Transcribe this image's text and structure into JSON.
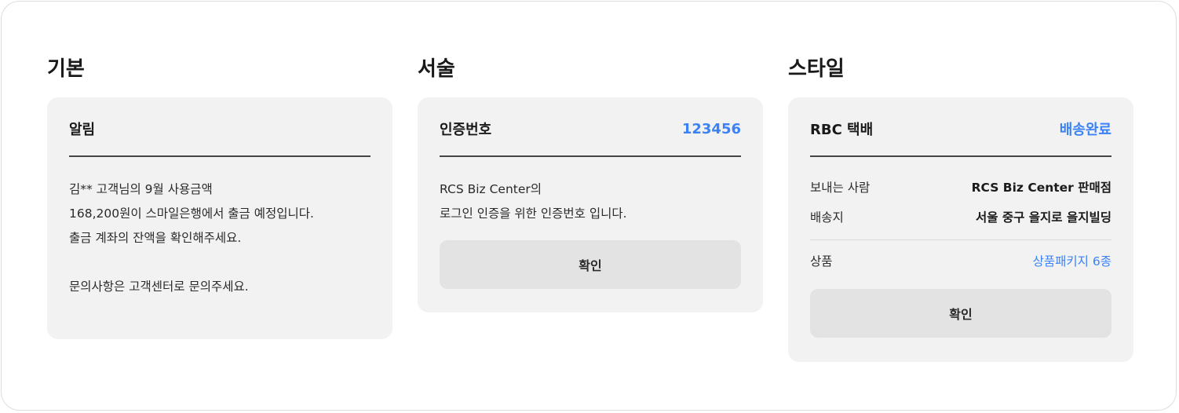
{
  "sections": {
    "basic": {
      "title": "기본",
      "card": {
        "header_title": "알림",
        "lines": [
          "김** 고객님의 9월 사용금액",
          "168,200원이 스마일은행에서 출금 예정입니다.",
          "출금 계좌의 잔액을 확인해주세요.",
          "문의사항은 고객센터로 문의주세요."
        ]
      }
    },
    "descriptive": {
      "title": "서술",
      "card": {
        "header_title": "인증번호",
        "header_value": "123456",
        "lines": [
          "RCS Biz Center의",
          "로그인 인증을 위한 인증번호 입니다."
        ],
        "button_label": "확인"
      }
    },
    "style": {
      "title": "스타일",
      "card": {
        "header_title": "RBC 택배",
        "header_value": "배송완료",
        "rows": [
          {
            "key": "보내는 사람",
            "value": "RCS Biz Center 판매점"
          },
          {
            "key": "배송지",
            "value": "서울 중구 을지로 을지빌딩"
          }
        ],
        "product_key": "상품",
        "product_value": "상품패키지 6종",
        "button_label": "확인"
      }
    }
  },
  "colors": {
    "accent": "#3b82f6",
    "card_bg": "#f2f2f2",
    "button_bg": "#e3e3e3",
    "header_rule": "#444444"
  }
}
